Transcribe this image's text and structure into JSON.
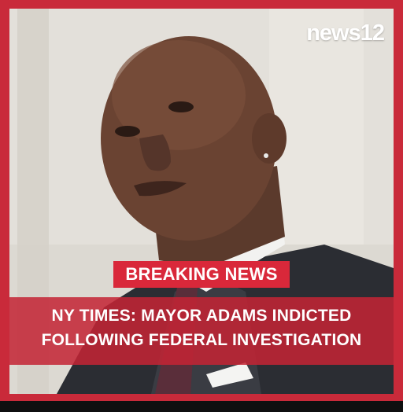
{
  "brand": {
    "logo_text": "news12",
    "frame_color": "#c92a3a",
    "accent_color": "#d9283a"
  },
  "banner": {
    "label": "BREAKING NEWS"
  },
  "headline": {
    "line1": "NY TIMES: MAYOR ADAMS INDICTED",
    "line2": "FOLLOWING FEDERAL INVESTIGATION"
  },
  "photo": {
    "subject": "man-in-suit-portrait"
  }
}
